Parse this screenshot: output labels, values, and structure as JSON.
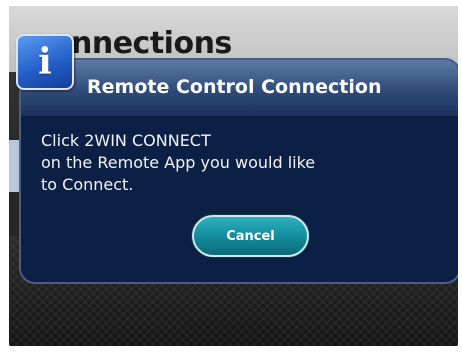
{
  "background": {
    "screen_title": "nnections"
  },
  "dialog": {
    "icon": "info-icon",
    "icon_glyph": "i",
    "title": "Remote Control Connection",
    "message_lines": [
      "Click 2WIN CONNECT",
      "on the Remote App you would like",
      "to Connect."
    ],
    "cancel_label": "Cancel"
  },
  "colors": {
    "dialog_bg": "#0c1f45",
    "button_accent": "#138a9b",
    "icon_blue": "#2460c9"
  }
}
